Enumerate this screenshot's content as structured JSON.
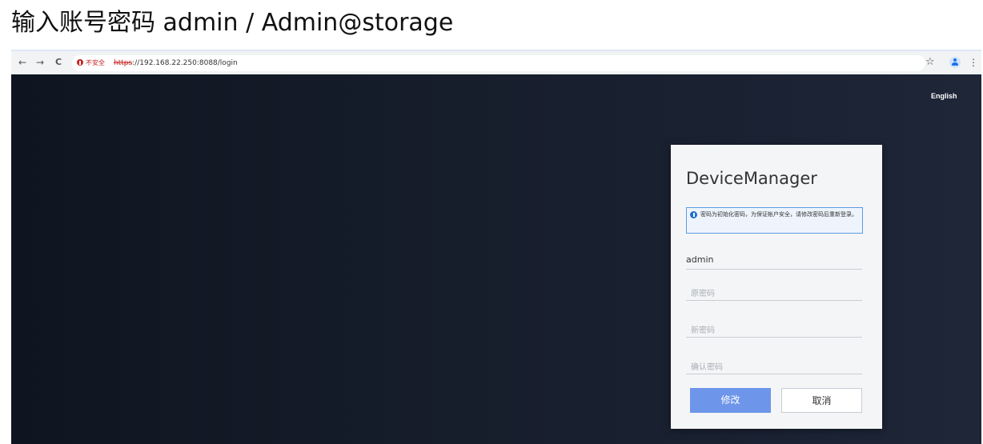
{
  "caption": "输入账号密码  admin / Admin@storage",
  "browser": {
    "back_glyph": "←",
    "forward_glyph": "→",
    "reload_glyph": "C",
    "insecure_label": "不安全",
    "url_scheme": "https",
    "url_rest": "://192.168.22.250:8088/login",
    "bookmark_glyph": "☆",
    "menu_glyph": "⋮",
    "icons": [
      "back-icon",
      "forward-icon",
      "reload-icon",
      "warning-icon",
      "star-icon",
      "profile-icon",
      "more-icon"
    ]
  },
  "page": {
    "language_link": "English",
    "card": {
      "title": "DeviceManager",
      "notice": "密码为初始化密码，为保证帐户安全，请修改密码后重新登录。",
      "username_value": "admin",
      "old_password_placeholder": "原密码",
      "new_password_placeholder": "新密码",
      "confirm_password_placeholder": "确认密码",
      "submit_label": "修改",
      "cancel_label": "取消"
    }
  },
  "colors": {
    "primary_button": "#6d95ea",
    "notice_border": "#5d9be0",
    "insecure_red": "#c5221f",
    "background_dark": "#161d2b"
  }
}
